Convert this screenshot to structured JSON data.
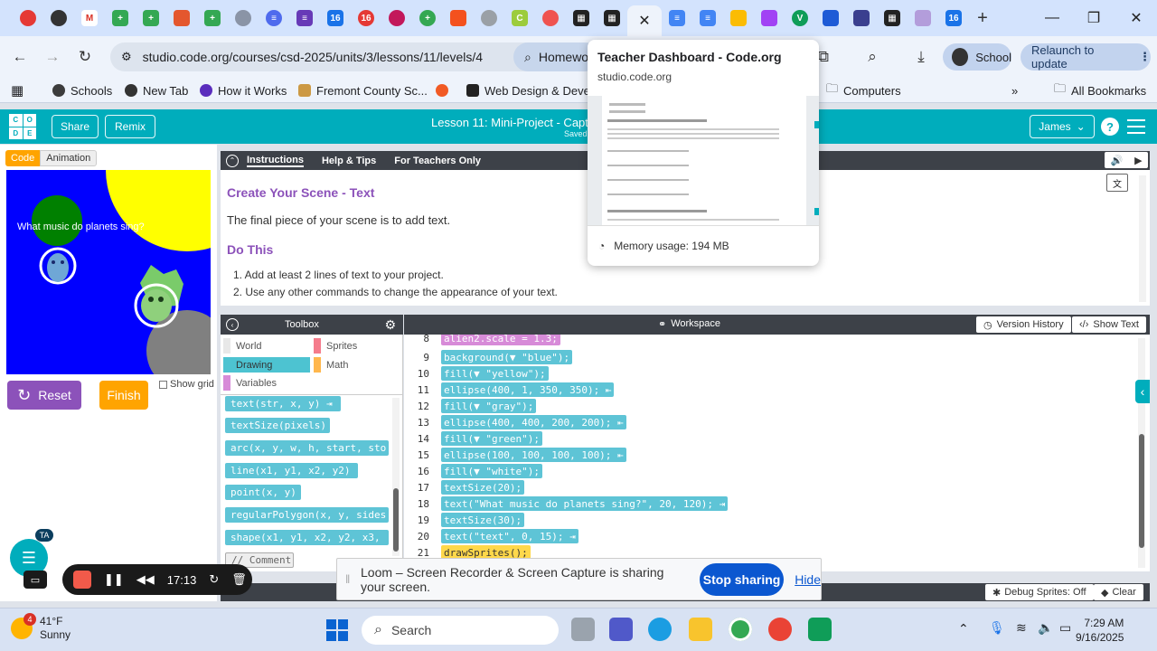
{
  "browser": {
    "url": "studio.code.org/courses/csd-2025/units/3/lessons/11/levels/4",
    "omnibox_tab": "Homewo",
    "profile_chip": "School",
    "relaunch_label": "Relaunch to update",
    "bookmarks": [
      {
        "label": "Schools",
        "color": "#3c3c3c"
      },
      {
        "label": "New Tab",
        "color": "#333333"
      },
      {
        "label": "How it Works",
        "color": "#5a2dbd"
      },
      {
        "label": "Fremont County Sc...",
        "color": "#c94"
      },
      {
        "label": "",
        "color": "#f15a24"
      },
      {
        "label": "Web Design & Deve...",
        "color": "#222"
      }
    ],
    "bookmark_folder": "Computers",
    "all_bookmarks": "All Bookmarks"
  },
  "tab_hover": {
    "title": "Teacher Dashboard - Code.org",
    "url": "studio.code.org",
    "memory": "Memory usage: 194 MB"
  },
  "header": {
    "logo_letters": [
      "C",
      "O",
      "D",
      "E"
    ],
    "share": "Share",
    "remix": "Remix",
    "lesson_title": "Lesson 11: Mini-Project - Captio",
    "saved": "Saved",
    "user": "James"
  },
  "play_area": {
    "mode_code": "Code",
    "mode_animation": "Animation",
    "stage_text": "What music do planets sing?",
    "reset": "Reset",
    "finish": "Finish",
    "show_grid": "Show grid"
  },
  "instructions": {
    "tabs": [
      "Instructions",
      "Help & Tips",
      "For Teachers Only"
    ],
    "heading": "Create Your Scene - Text",
    "intro": "The final piece of your scene is to add text.",
    "do_this": "Do This",
    "steps": [
      "1. Add at least 2 lines of text to your project.",
      "2. Use any other commands to change the appearance of your text."
    ]
  },
  "toolbox": {
    "title": "Toolbox",
    "categories": [
      {
        "label": "World",
        "color": "#e8e8e8"
      },
      {
        "label": "Sprites",
        "color": "#f57c8c"
      },
      {
        "label": "Drawing",
        "color": "#4dc3d1"
      },
      {
        "label": "Math",
        "color": "#ffb74d"
      },
      {
        "label": "Variables",
        "color": "#d78bd8"
      }
    ],
    "blocks": [
      "text(str, x, y) ⇥",
      "textSize(pixels)",
      "arc(x, y, w, h, start, sto",
      "line(x1, y1, x2, y2)",
      "point(x, y)",
      "regularPolygon(x, y, sides",
      "shape(x1, y1, x2, y2, x3,",
      "// Comment"
    ]
  },
  "workspace": {
    "title": "Workspace",
    "version_history": "Version History",
    "show_text": "Show Text",
    "lines": [
      {
        "n": "8",
        "code": "alien2.scale = 1.3;",
        "style": "pink"
      },
      {
        "n": "9",
        "code": "background(▼ \"blue\");",
        "style": "cyan"
      },
      {
        "n": "10",
        "code": "fill(▼ \"yellow\");",
        "style": "cyan"
      },
      {
        "n": "11",
        "code": "ellipse(400, 1, 350, 350); ⇤",
        "style": "cyan"
      },
      {
        "n": "12",
        "code": "fill(▼ \"gray\");",
        "style": "cyan"
      },
      {
        "n": "13",
        "code": "ellipse(400, 400, 200, 200); ⇤",
        "style": "cyan"
      },
      {
        "n": "14",
        "code": "fill(▼ \"green\");",
        "style": "cyan"
      },
      {
        "n": "15",
        "code": "ellipse(100, 100, 100, 100); ⇤",
        "style": "cyan"
      },
      {
        "n": "16",
        "code": "fill(▼ \"white\");",
        "style": "cyan"
      },
      {
        "n": "17",
        "code": "textSize(20);",
        "style": "cyan"
      },
      {
        "n": "18",
        "code": "text(\"What music do planets sing?\", 20, 120); ⇥",
        "style": "cyan"
      },
      {
        "n": "19",
        "code": "textSize(30);",
        "style": "cyan"
      },
      {
        "n": "20",
        "code": "text(\"text\", 0, 15); ⇥",
        "style": "cyan"
      },
      {
        "n": "21",
        "code": "drawSprites();",
        "style": "yellow"
      }
    ]
  },
  "loom": {
    "message": "Loom – Screen Recorder & Screen Capture is sharing your screen.",
    "stop": "Stop sharing",
    "hide": "Hide"
  },
  "recorder": {
    "time": "17:13",
    "badge": "TA"
  },
  "debug": {
    "debug_sprites": "Debug Sprites: Off",
    "clear": "Clear"
  },
  "taskbar": {
    "temp": "41°F",
    "condition": "Sunny",
    "badge": "4",
    "search": "Search",
    "time": "7:29 AM",
    "date": "9/16/2025"
  }
}
